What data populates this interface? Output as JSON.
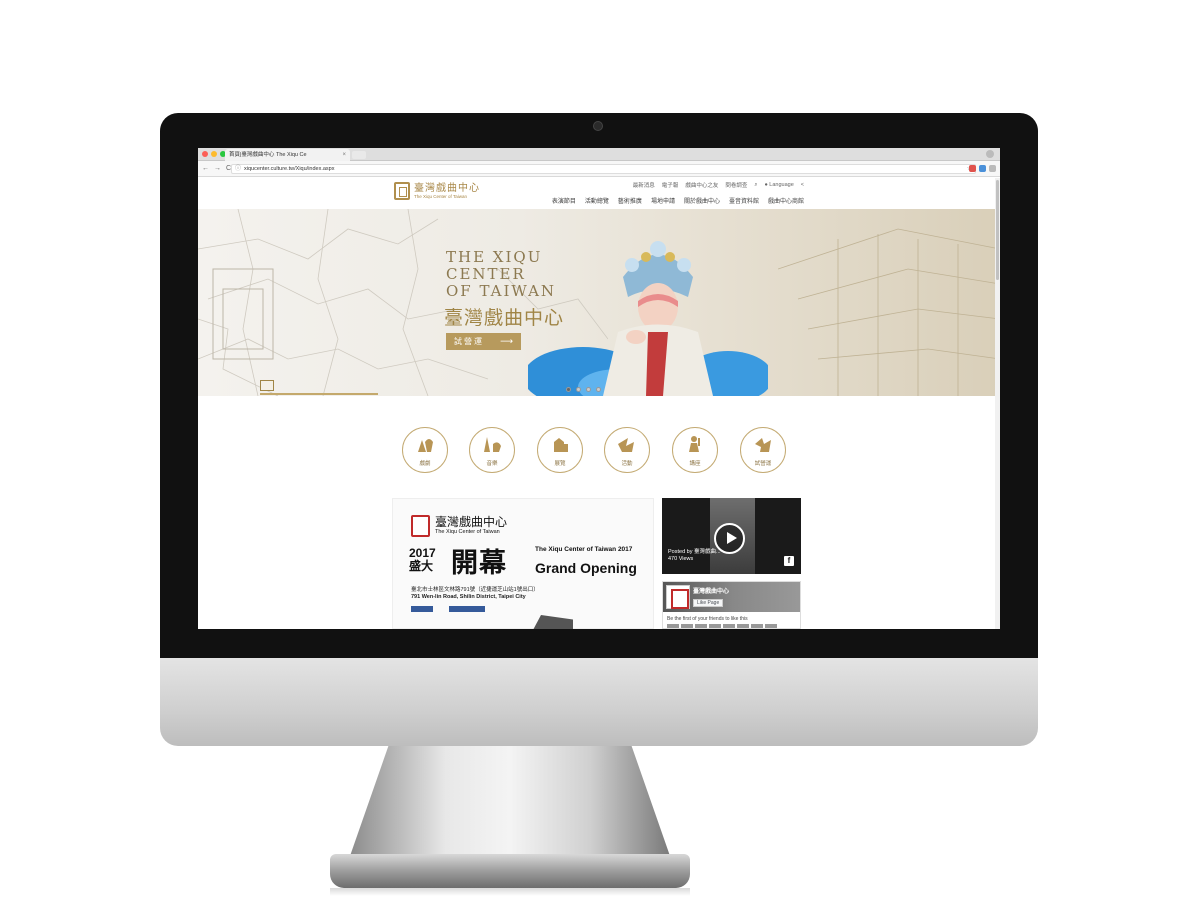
{
  "browser": {
    "tab_title": "首頁|臺灣戲曲中心 The Xiqu Ce",
    "tab_close": "×",
    "url": "xiqucenter.culture.tw/Xiqu/index.aspx",
    "nav_back": "←",
    "nav_forward": "→",
    "nav_reload": "C",
    "info_icon": "ⓘ",
    "star_icon": "☆"
  },
  "site": {
    "logo_cn": "臺灣戲曲中心",
    "logo_en": "The Xiqu Center of Taiwan",
    "utility_links": [
      "最新消息",
      "電子報",
      "戲曲中心之友",
      "問卷調查"
    ],
    "search_icon": "⌕",
    "language": "Language",
    "language_icon": "●",
    "share_icon": "<",
    "main_nav": [
      "表演節目",
      "活動總覽",
      "藝術推廣",
      "場地申請",
      "關於戲曲中心",
      "臺音資料館",
      "戲曲中心商館"
    ]
  },
  "hero": {
    "title_lines": [
      "THE XIQU",
      "CENTER",
      "OF TAIWAN"
    ],
    "title_cn": "臺灣戲曲中心",
    "button_label": "試營運",
    "button_arrow": "⟶",
    "slide_count": 4,
    "active_slide": 1
  },
  "categories": [
    {
      "label": "戲劇",
      "icon": "opera-icon"
    },
    {
      "label": "音樂",
      "icon": "music-icon"
    },
    {
      "label": "展覽",
      "icon": "exhibition-icon"
    },
    {
      "label": "活動",
      "icon": "event-icon"
    },
    {
      "label": "講座",
      "icon": "lecture-icon"
    },
    {
      "label": "試營運",
      "icon": "trial-run-icon"
    }
  ],
  "poster": {
    "logo_cn": "臺灣戲曲中心",
    "logo_en": "The Xiqu Center of Taiwan",
    "year": "2017",
    "grand": "盛大",
    "big_cn": "開幕",
    "en_line1": "The Xiqu Center of Taiwan 2017",
    "en_line2": "Grand Opening",
    "address_cn": "臺北市士林區文林路791號（近捷運芝山站1號出口）",
    "address_en": "791 Wen-lin Road, Shilin District, Taipei City"
  },
  "video": {
    "posted_by": "Posted by 臺灣戲曲...",
    "views": "470 Views",
    "fb_glyph": "f"
  },
  "facebook": {
    "page_name": "臺灣戲曲中心",
    "like_label": "Like Page",
    "friends_text": "Be the first of your friends to like this"
  },
  "colors": {
    "gold": "#b08f4d",
    "brand_red": "#c02a2a",
    "bezel": "#111111"
  }
}
